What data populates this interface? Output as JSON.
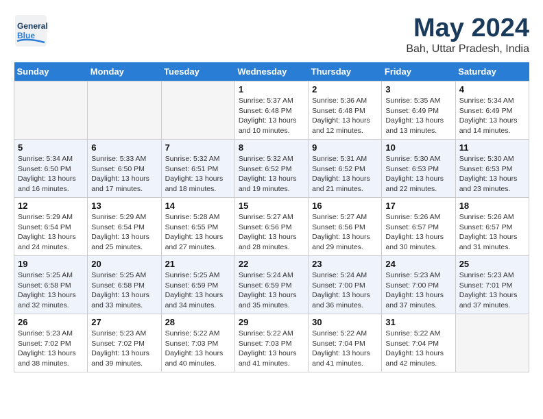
{
  "header": {
    "logo_general": "General",
    "logo_blue": "Blue",
    "month_title": "May 2024",
    "location": "Bah, Uttar Pradesh, India"
  },
  "weekdays": [
    "Sunday",
    "Monday",
    "Tuesday",
    "Wednesday",
    "Thursday",
    "Friday",
    "Saturday"
  ],
  "weeks": [
    {
      "row_style": "odd",
      "days": [
        {
          "num": "",
          "info": "",
          "empty": true
        },
        {
          "num": "",
          "info": "",
          "empty": true
        },
        {
          "num": "",
          "info": "",
          "empty": true
        },
        {
          "num": "1",
          "info": "Sunrise: 5:37 AM\nSunset: 6:48 PM\nDaylight: 13 hours\nand 10 minutes.",
          "empty": false
        },
        {
          "num": "2",
          "info": "Sunrise: 5:36 AM\nSunset: 6:48 PM\nDaylight: 13 hours\nand 12 minutes.",
          "empty": false
        },
        {
          "num": "3",
          "info": "Sunrise: 5:35 AM\nSunset: 6:49 PM\nDaylight: 13 hours\nand 13 minutes.",
          "empty": false
        },
        {
          "num": "4",
          "info": "Sunrise: 5:34 AM\nSunset: 6:49 PM\nDaylight: 13 hours\nand 14 minutes.",
          "empty": false
        }
      ]
    },
    {
      "row_style": "even",
      "days": [
        {
          "num": "5",
          "info": "Sunrise: 5:34 AM\nSunset: 6:50 PM\nDaylight: 13 hours\nand 16 minutes.",
          "empty": false
        },
        {
          "num": "6",
          "info": "Sunrise: 5:33 AM\nSunset: 6:50 PM\nDaylight: 13 hours\nand 17 minutes.",
          "empty": false
        },
        {
          "num": "7",
          "info": "Sunrise: 5:32 AM\nSunset: 6:51 PM\nDaylight: 13 hours\nand 18 minutes.",
          "empty": false
        },
        {
          "num": "8",
          "info": "Sunrise: 5:32 AM\nSunset: 6:52 PM\nDaylight: 13 hours\nand 19 minutes.",
          "empty": false
        },
        {
          "num": "9",
          "info": "Sunrise: 5:31 AM\nSunset: 6:52 PM\nDaylight: 13 hours\nand 21 minutes.",
          "empty": false
        },
        {
          "num": "10",
          "info": "Sunrise: 5:30 AM\nSunset: 6:53 PM\nDaylight: 13 hours\nand 22 minutes.",
          "empty": false
        },
        {
          "num": "11",
          "info": "Sunrise: 5:30 AM\nSunset: 6:53 PM\nDaylight: 13 hours\nand 23 minutes.",
          "empty": false
        }
      ]
    },
    {
      "row_style": "odd",
      "days": [
        {
          "num": "12",
          "info": "Sunrise: 5:29 AM\nSunset: 6:54 PM\nDaylight: 13 hours\nand 24 minutes.",
          "empty": false
        },
        {
          "num": "13",
          "info": "Sunrise: 5:29 AM\nSunset: 6:54 PM\nDaylight: 13 hours\nand 25 minutes.",
          "empty": false
        },
        {
          "num": "14",
          "info": "Sunrise: 5:28 AM\nSunset: 6:55 PM\nDaylight: 13 hours\nand 27 minutes.",
          "empty": false
        },
        {
          "num": "15",
          "info": "Sunrise: 5:27 AM\nSunset: 6:56 PM\nDaylight: 13 hours\nand 28 minutes.",
          "empty": false
        },
        {
          "num": "16",
          "info": "Sunrise: 5:27 AM\nSunset: 6:56 PM\nDaylight: 13 hours\nand 29 minutes.",
          "empty": false
        },
        {
          "num": "17",
          "info": "Sunrise: 5:26 AM\nSunset: 6:57 PM\nDaylight: 13 hours\nand 30 minutes.",
          "empty": false
        },
        {
          "num": "18",
          "info": "Sunrise: 5:26 AM\nSunset: 6:57 PM\nDaylight: 13 hours\nand 31 minutes.",
          "empty": false
        }
      ]
    },
    {
      "row_style": "even",
      "days": [
        {
          "num": "19",
          "info": "Sunrise: 5:25 AM\nSunset: 6:58 PM\nDaylight: 13 hours\nand 32 minutes.",
          "empty": false
        },
        {
          "num": "20",
          "info": "Sunrise: 5:25 AM\nSunset: 6:58 PM\nDaylight: 13 hours\nand 33 minutes.",
          "empty": false
        },
        {
          "num": "21",
          "info": "Sunrise: 5:25 AM\nSunset: 6:59 PM\nDaylight: 13 hours\nand 34 minutes.",
          "empty": false
        },
        {
          "num": "22",
          "info": "Sunrise: 5:24 AM\nSunset: 6:59 PM\nDaylight: 13 hours\nand 35 minutes.",
          "empty": false
        },
        {
          "num": "23",
          "info": "Sunrise: 5:24 AM\nSunset: 7:00 PM\nDaylight: 13 hours\nand 36 minutes.",
          "empty": false
        },
        {
          "num": "24",
          "info": "Sunrise: 5:23 AM\nSunset: 7:00 PM\nDaylight: 13 hours\nand 37 minutes.",
          "empty": false
        },
        {
          "num": "25",
          "info": "Sunrise: 5:23 AM\nSunset: 7:01 PM\nDaylight: 13 hours\nand 37 minutes.",
          "empty": false
        }
      ]
    },
    {
      "row_style": "odd",
      "days": [
        {
          "num": "26",
          "info": "Sunrise: 5:23 AM\nSunset: 7:02 PM\nDaylight: 13 hours\nand 38 minutes.",
          "empty": false
        },
        {
          "num": "27",
          "info": "Sunrise: 5:23 AM\nSunset: 7:02 PM\nDaylight: 13 hours\nand 39 minutes.",
          "empty": false
        },
        {
          "num": "28",
          "info": "Sunrise: 5:22 AM\nSunset: 7:03 PM\nDaylight: 13 hours\nand 40 minutes.",
          "empty": false
        },
        {
          "num": "29",
          "info": "Sunrise: 5:22 AM\nSunset: 7:03 PM\nDaylight: 13 hours\nand 41 minutes.",
          "empty": false
        },
        {
          "num": "30",
          "info": "Sunrise: 5:22 AM\nSunset: 7:04 PM\nDaylight: 13 hours\nand 41 minutes.",
          "empty": false
        },
        {
          "num": "31",
          "info": "Sunrise: 5:22 AM\nSunset: 7:04 PM\nDaylight: 13 hours\nand 42 minutes.",
          "empty": false
        },
        {
          "num": "",
          "info": "",
          "empty": true
        }
      ]
    }
  ]
}
